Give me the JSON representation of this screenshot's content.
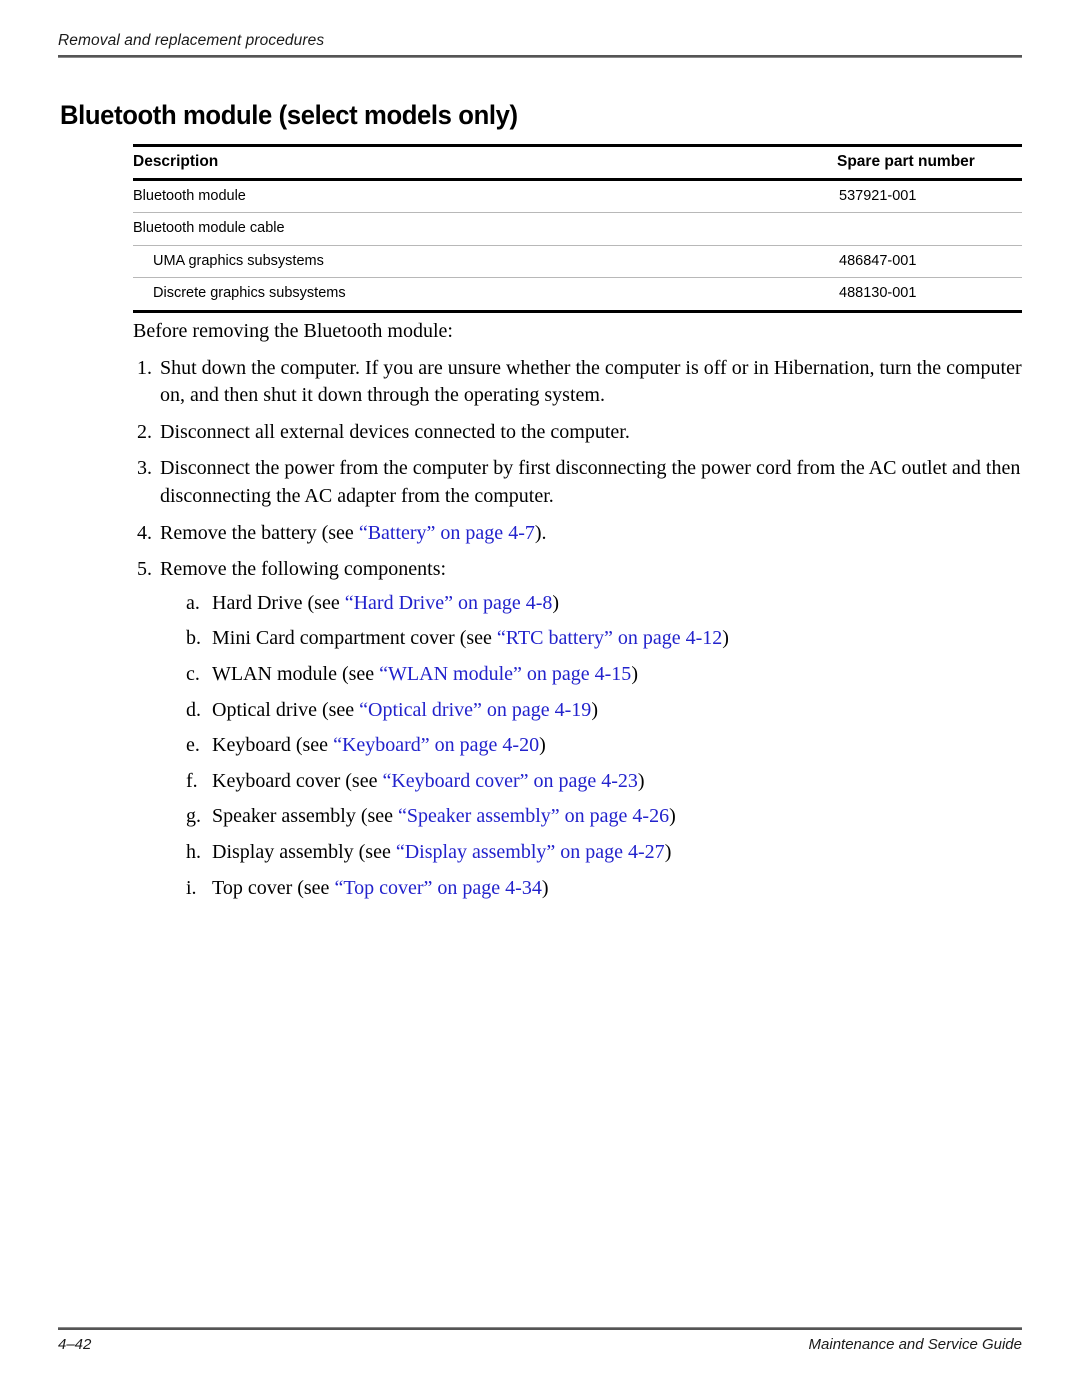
{
  "running_header": {
    "text": "Removal and replacement procedures"
  },
  "page_title": "Bluetooth module (select models only)",
  "parts_table": {
    "headers": {
      "description": "Description",
      "spare_part_number": "Spare part number"
    },
    "rows": [
      {
        "description": "Bluetooth module",
        "part_number": "537921-001",
        "indented": false
      },
      {
        "description": "Bluetooth module cable",
        "part_number": "",
        "indented": false
      },
      {
        "description": "UMA graphics subsystems",
        "part_number": "486847-001",
        "indented": true
      },
      {
        "description": "Discrete graphics subsystems",
        "part_number": "488130-001",
        "indented": true
      }
    ]
  },
  "body": {
    "lead_paragraph": "Before removing the Bluetooth module:",
    "steps": [
      {
        "marker": "1.",
        "text": "Shut down the computer. If you are unsure whether the computer is off or in Hibernation, turn the computer on, and then shut it down through the operating system."
      },
      {
        "marker": "2.",
        "text": "Disconnect all external devices connected to the computer."
      },
      {
        "marker": "3.",
        "text": "Disconnect the power from the computer by first disconnecting the power cord from the AC outlet and then disconnecting the AC adapter from the computer."
      },
      {
        "marker": "4.",
        "prefix": "Remove the battery (see ",
        "link": "“Battery” on page 4-7",
        "suffix": ")."
      },
      {
        "marker": "5.",
        "text": "Remove the following components:"
      }
    ],
    "subcomponents": [
      {
        "marker": "a.",
        "prefix": "Hard Drive (see ",
        "link": "“Hard Drive” on page 4-8",
        "suffix": ")"
      },
      {
        "marker": "b.",
        "prefix": "Mini Card compartment cover (see ",
        "link": "“RTC battery” on page 4-12",
        "suffix": ")"
      },
      {
        "marker": "c.",
        "prefix": "WLAN module (see ",
        "link": "“WLAN module” on page 4-15",
        "suffix": ")"
      },
      {
        "marker": "d.",
        "prefix": "Optical drive (see ",
        "link": "“Optical drive” on page 4-19",
        "suffix": ")"
      },
      {
        "marker": "e.",
        "prefix": "Keyboard (see ",
        "link": "“Keyboard” on page 4-20",
        "suffix": ")"
      },
      {
        "marker": "f.",
        "prefix": "Keyboard cover (see ",
        "link": "“Keyboard cover” on page 4-23",
        "suffix": ")"
      },
      {
        "marker": "g.",
        "prefix": "Speaker assembly (see ",
        "link": "“Speaker assembly” on page 4-26",
        "suffix": ")"
      },
      {
        "marker": "h.",
        "prefix": "Display assembly (see ",
        "link": "“Display assembly” on page 4-27",
        "suffix": ")"
      },
      {
        "marker": "i.",
        "prefix": "Top cover (see ",
        "link": "“Top cover” on page 4-34",
        "suffix": ")"
      }
    ]
  },
  "footer": {
    "page_number": "4–42",
    "guide_title": "Maintenance and Service Guide"
  },
  "colors": {
    "link_blue": "#2222cc",
    "rule_gray": "#555555",
    "table_rule": "#000000"
  }
}
